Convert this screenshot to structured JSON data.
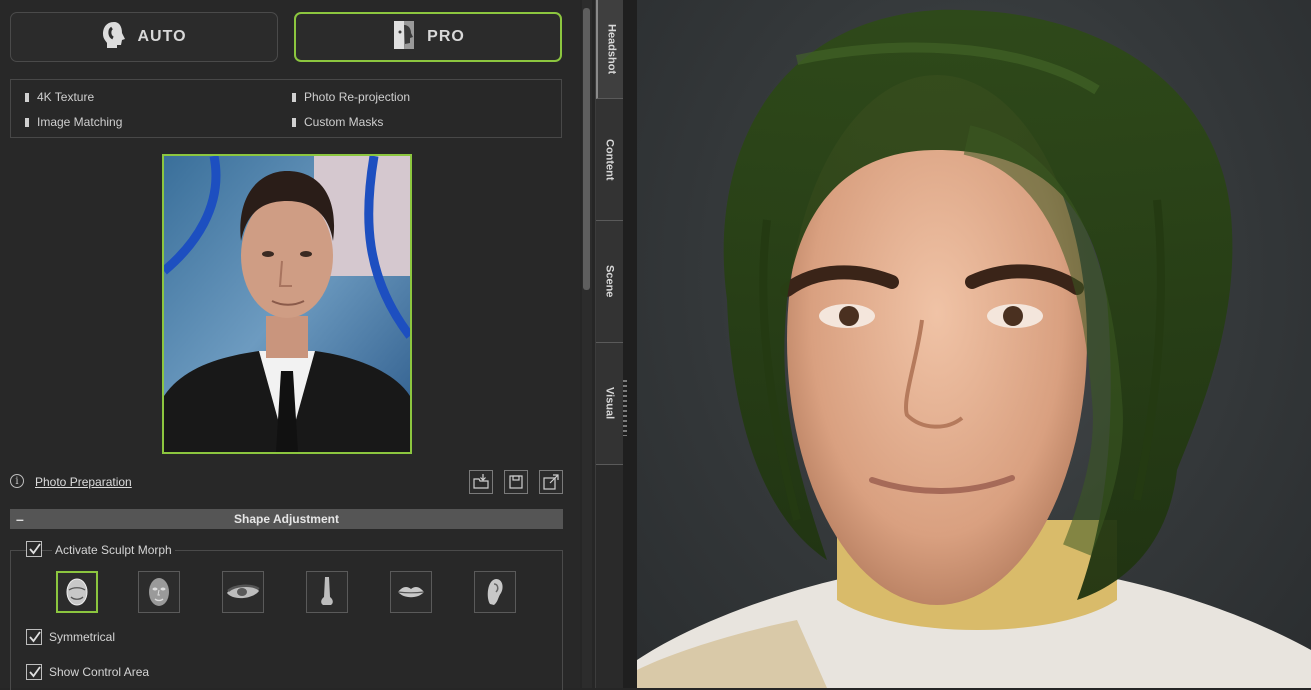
{
  "mode": {
    "auto_label": "AUTO",
    "pro_label": "PRO",
    "selected": "PRO"
  },
  "features": [
    {
      "label": "4K Texture"
    },
    {
      "label": "Photo Re-projection"
    },
    {
      "label": "Image Matching"
    },
    {
      "label": "Custom Masks"
    }
  ],
  "photo": {
    "link_label": "Photo Preparation"
  },
  "shape": {
    "section_title": "Shape Adjustment",
    "activate_label": "Activate Sculpt Morph",
    "activate_checked": true,
    "parts": [
      "head-icon",
      "face-icon",
      "eye-icon",
      "nose-icon",
      "lips-icon",
      "ear-icon"
    ],
    "selected_part": "head-icon",
    "symmetrical_label": "Symmetrical",
    "symmetrical_checked": true,
    "show_area_label": "Show Control Area",
    "show_area_checked": true
  },
  "side_tabs": [
    {
      "label": "Headshot",
      "active": true
    },
    {
      "label": "Content",
      "active": false
    },
    {
      "label": "Scene",
      "active": false
    },
    {
      "label": "Visual",
      "active": false
    }
  ],
  "colors": {
    "accent": "#8cc63f",
    "panel": "#282828",
    "section_header": "#555555"
  }
}
